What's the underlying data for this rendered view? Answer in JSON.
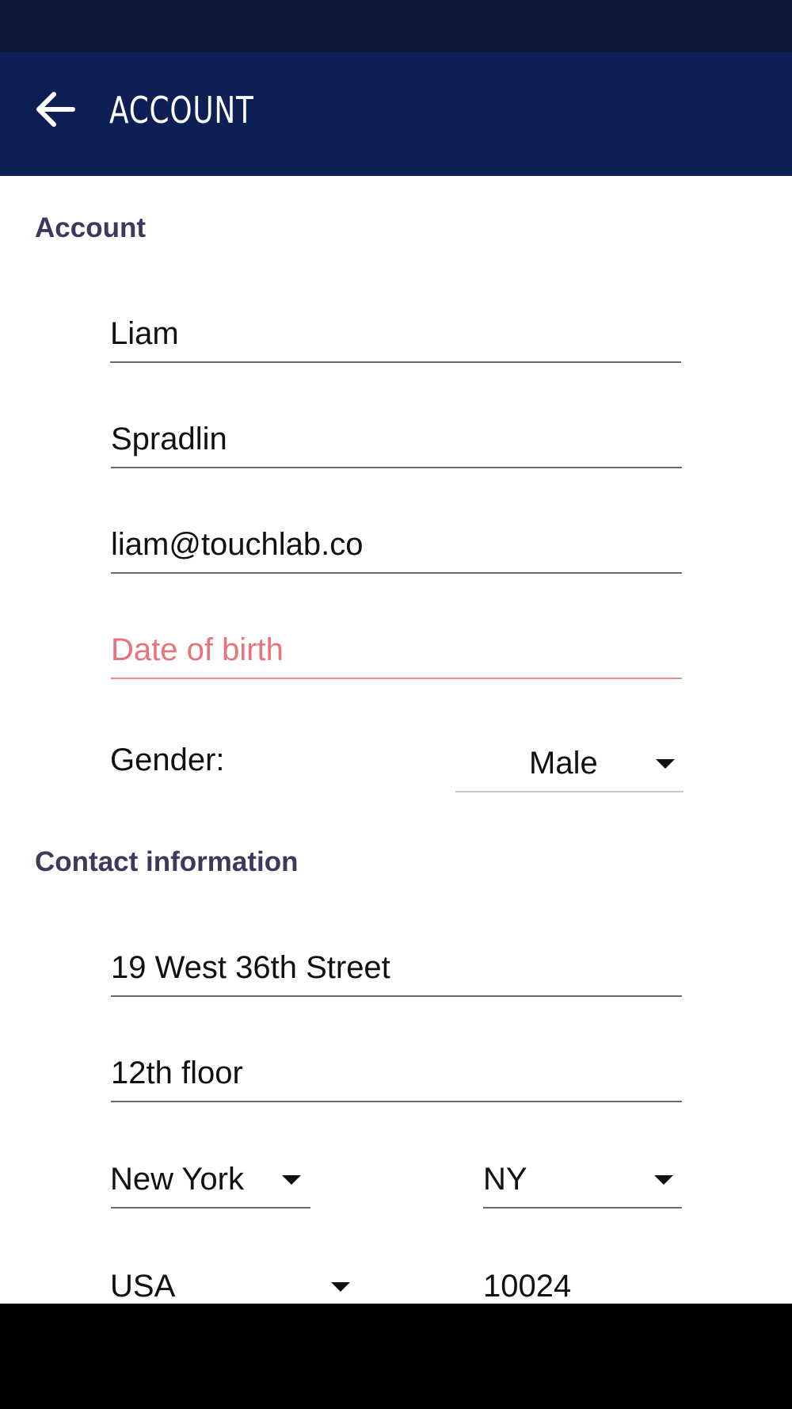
{
  "app_bar": {
    "title": "ACCOUNT",
    "back_icon": "arrow-left-icon"
  },
  "account_section": {
    "header": "Account",
    "first_name": "Liam",
    "last_name": "Spradlin",
    "email": "liam@touchlab.co",
    "dob_placeholder": "Date of birth",
    "gender_label": "Gender:",
    "gender_value": "Male"
  },
  "contact_section": {
    "header": "Contact information",
    "address1": "19 West 36th Street",
    "address2": "12th floor",
    "city": "New York",
    "state": "NY",
    "country": "USA",
    "zip": "10024"
  },
  "colors": {
    "status_bar": "#0c1838",
    "app_bar": "#0e1f56",
    "section_header": "#3a3b5c",
    "error": "#e8737c"
  }
}
